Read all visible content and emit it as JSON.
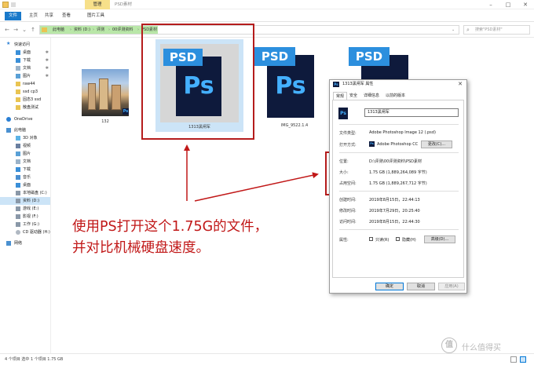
{
  "window": {
    "title": "PSD素材",
    "context_tab": "管理"
  },
  "ribbon": {
    "tabs": [
      "文件",
      "主页",
      "共享",
      "查看",
      "图片工具"
    ]
  },
  "address": {
    "crumbs": [
      "此电脑",
      "资料 (D:)",
      "评测",
      "00评测资料",
      "PSD素材"
    ],
    "search_placeholder": "搜索\"PSD素材\""
  },
  "nav_pane": {
    "items": [
      {
        "label": "快速访问",
        "icon": "star-icon"
      },
      {
        "label": "桌面",
        "icon": "desktop-icon",
        "pinned": true
      },
      {
        "label": "下载",
        "icon": "download-icon",
        "pinned": true
      },
      {
        "label": "文档",
        "icon": "document-icon",
        "pinned": true
      },
      {
        "label": "图片",
        "icon": "picture-icon",
        "pinned": true
      },
      {
        "label": "raw44",
        "icon": "folder-icon"
      },
      {
        "label": "ssd cp3",
        "icon": "folder-icon"
      },
      {
        "label": "固态3 ssd",
        "icon": "folder-icon"
      },
      {
        "label": "散盘测试",
        "icon": "folder-icon"
      },
      {
        "label": "OneDrive",
        "icon": "cloud-icon"
      },
      {
        "label": "此电脑",
        "icon": "computer-icon"
      },
      {
        "label": "3D 对象",
        "icon": "cube-icon"
      },
      {
        "label": "视频",
        "icon": "video-icon"
      },
      {
        "label": "图片",
        "icon": "picture-icon"
      },
      {
        "label": "文档",
        "icon": "document-icon"
      },
      {
        "label": "下载",
        "icon": "download-icon"
      },
      {
        "label": "音乐",
        "icon": "music-icon"
      },
      {
        "label": "桌面",
        "icon": "desktop-icon"
      },
      {
        "label": "本地磁盘 (C:)",
        "icon": "drive-icon"
      },
      {
        "label": "资料 (D:)",
        "icon": "drive-icon",
        "selected": true
      },
      {
        "label": "游戏 (E:)",
        "icon": "drive-icon"
      },
      {
        "label": "影视 (F:)",
        "icon": "drive-icon"
      },
      {
        "label": "工作 (G:)",
        "icon": "drive-icon"
      },
      {
        "label": "CD 驱动器 (H:)",
        "icon": "cd-drive-icon"
      },
      {
        "label": "网络",
        "icon": "network-icon"
      }
    ]
  },
  "files": [
    {
      "name": "132",
      "type": "image"
    },
    {
      "name": "1313黑闸军",
      "type": "psd",
      "selected": true
    },
    {
      "name": "IMG_9522.1.4",
      "type": "psd"
    },
    {
      "name": "",
      "type": "psd"
    }
  ],
  "ps_labels": {
    "tab": "PSD",
    "logo": "Ps"
  },
  "annotation": {
    "line1": "使用PS打开这个1.75G的文件，",
    "line2": "并对比机械硬盘速度。"
  },
  "dialog": {
    "title": "1313黑闸军 属性",
    "tabs": [
      "常规",
      "安全",
      "详细信息",
      "以前的版本"
    ],
    "file_name": "1313黑闸军",
    "file_type_label": "文件类型:",
    "file_type": "Adobe Photoshop Image 12 (.psd)",
    "open_with_label": "打开方式:",
    "open_with": "Adobe Photoshop CC",
    "change_button": "更改(C)...",
    "location_label": "位置:",
    "location": "D:\\评测\\00评测资料\\PSD素材",
    "size_label": "大小:",
    "size": "1.75 GB (1,889,264,089 字节)",
    "size_on_disk_label": "占用空间:",
    "size_on_disk": "1.75 GB (1,889,267,712 字节)",
    "created_label": "创建时间:",
    "created": "2019年8月15日，22:44:13",
    "modified_label": "修改时间:",
    "modified": "2019年7月29日，20:25:40",
    "accessed_label": "访问时间:",
    "accessed": "2019年8月15日，22:44:30",
    "attributes_label": "属性:",
    "readonly_label": "只读(R)",
    "hidden_label": "隐藏(H)",
    "advanced_button": "高级(D)...",
    "ok_button": "确定",
    "cancel_button": "取消",
    "apply_button": "应用(A)"
  },
  "status": {
    "text": "4 个项目    选中 1 个项目  1.75 GB"
  },
  "watermark": {
    "logo": "值",
    "text": "什么值得买"
  },
  "colors": {
    "ps_tab": "#2c8fde",
    "ps_body": "#0e1a3c",
    "ps_text": "#44b0ff",
    "callout_red": "#b51c1c",
    "accent_blue": "#1979ca"
  }
}
